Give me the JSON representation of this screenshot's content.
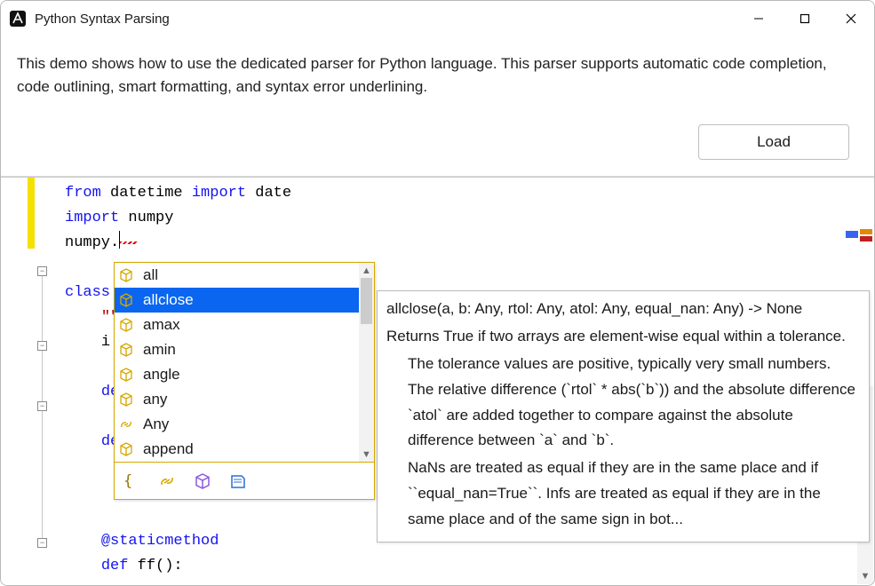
{
  "window": {
    "title": "Python Syntax Parsing"
  },
  "header": {
    "description": "This demo shows how to use the dedicated parser for Python language. This parser supports automatic code completion, code outlining, smart formatting, and syntax error underlining.",
    "load_label": "Load"
  },
  "code": {
    "line1_from": "from",
    "line1_mod": " datetime ",
    "line1_import": "import",
    "line1_name": " date",
    "line2_import": "import",
    "line2_name": " numpy",
    "line3_prefix": "numpy.",
    "line5_class": "class",
    "line6_doc": "\"\"",
    "line7_i": "i",
    "line9_def": "de",
    "line11_def": "de",
    "line15_dec": "@staticmethod",
    "line16_def": "def",
    "line16_name": " ff():"
  },
  "completion": {
    "items": [
      {
        "label": "all",
        "icon": "cube"
      },
      {
        "label": "allclose",
        "icon": "cube",
        "selected": true
      },
      {
        "label": "amax",
        "icon": "cube"
      },
      {
        "label": "amin",
        "icon": "cube"
      },
      {
        "label": "angle",
        "icon": "cube"
      },
      {
        "label": "any",
        "icon": "cube"
      },
      {
        "label": "Any",
        "icon": "link"
      },
      {
        "label": "append",
        "icon": "cube"
      }
    ],
    "footer_icons": [
      "braces-icon",
      "link-icon",
      "cube-icon",
      "book-icon"
    ]
  },
  "tooltip": {
    "signature": "allclose(a, b: Any, rtol: Any, atol: Any, equal_nan: Any) -> None",
    "summary": "Returns True if two arrays are element-wise equal within a tolerance.",
    "body1": "The tolerance values are positive, typically very small numbers.  The relative difference (`rtol` * abs(`b`)) and the absolute difference `atol` are added together to compare against the absolute difference between `a` and `b`.",
    "body2": "NaNs are treated as equal if they are in the same place and if ``equal_nan=True``.  Infs are treated as equal if they are in the same place and of the same sign in bot..."
  }
}
